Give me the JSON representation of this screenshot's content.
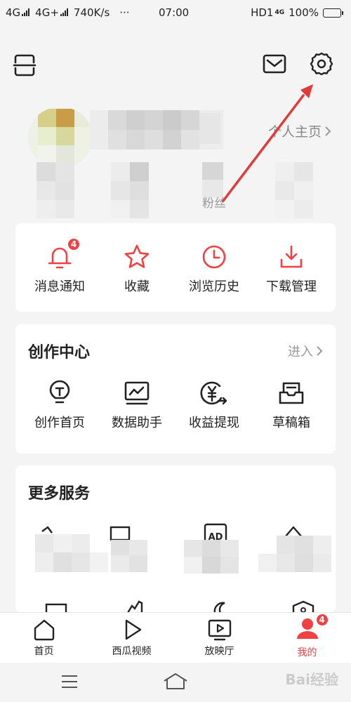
{
  "status_bar": {
    "network1": "4G",
    "network2": "4G+",
    "speed": "740K/s",
    "dots": "···",
    "time": "07:00",
    "hd": "HD1",
    "signal_badge": "4G",
    "battery": "100%"
  },
  "profile": {
    "homepage_link": "个人主页",
    "fans_label": "粉丝"
  },
  "quick_actions": {
    "items": [
      {
        "label": "消息通知",
        "icon": "bell-icon",
        "badge": "4"
      },
      {
        "label": "收藏",
        "icon": "star-icon"
      },
      {
        "label": "浏览历史",
        "icon": "clock-icon"
      },
      {
        "label": "下载管理",
        "icon": "download-icon"
      }
    ]
  },
  "creation_center": {
    "title": "创作中心",
    "enter_link": "进入",
    "items": [
      {
        "label": "创作首页",
        "icon": "lightbulb-icon"
      },
      {
        "label": "数据助手",
        "icon": "chart-monitor-icon"
      },
      {
        "label": "收益提现",
        "icon": "yuan-withdraw-icon"
      },
      {
        "label": "草稿箱",
        "icon": "draft-box-icon"
      }
    ]
  },
  "more_services": {
    "title": "更多服务",
    "tile_text": "AD"
  },
  "bottom_nav": {
    "items": [
      {
        "label": "首页",
        "icon": "home-icon"
      },
      {
        "label": "西瓜视频",
        "icon": "play-icon"
      },
      {
        "label": "放映厅",
        "icon": "tv-play-icon"
      },
      {
        "label": "我的",
        "icon": "user-icon",
        "badge": "4",
        "active": true
      }
    ]
  },
  "watermark": "Bai经验",
  "colors": {
    "accent": "#f04142",
    "background": "#f4f4f4",
    "card": "#ffffff",
    "annotation_arrow": "#e03b3b"
  }
}
